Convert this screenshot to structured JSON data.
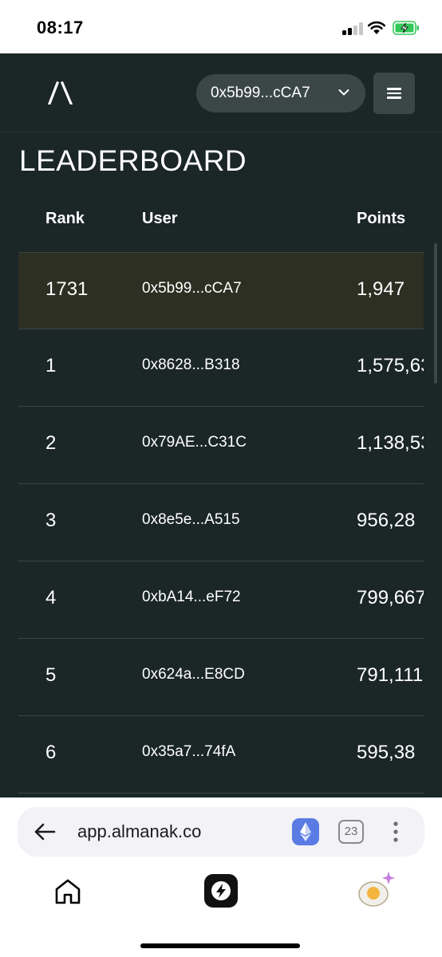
{
  "status_bar": {
    "time": "08:17"
  },
  "header": {
    "wallet_label": "0x5b99...cCA7"
  },
  "page": {
    "title": "LEADERBOARD"
  },
  "table": {
    "columns": [
      "Rank",
      "User",
      "Points"
    ],
    "rows": [
      {
        "rank": "1731",
        "user": "0x5b99...cCA7",
        "points": "1,947",
        "highlight": true
      },
      {
        "rank": "1",
        "user": "0x8628...B318",
        "points": "1,575,63"
      },
      {
        "rank": "2",
        "user": "0x79AE...C31C",
        "points": "1,138,53"
      },
      {
        "rank": "3",
        "user": "0x8e5e...A515",
        "points": "956,28"
      },
      {
        "rank": "4",
        "user": "0xbA14...eF72",
        "points": "799,667"
      },
      {
        "rank": "5",
        "user": "0x624a...E8CD",
        "points": "791,111"
      },
      {
        "rank": "6",
        "user": "0x35a7...74fA",
        "points": "595,38"
      }
    ]
  },
  "browser": {
    "url": "app.almanak.co",
    "tab_count": "23"
  },
  "colors": {
    "app_background": "#1b2626",
    "highlight_row": "#2c2f22",
    "button_background": "#3b4646",
    "battery_charging": "#34c759"
  },
  "icons": [
    "almanak-logo-icon",
    "chevron-down-icon",
    "menu-icon",
    "back-arrow-icon",
    "ethereum-icon",
    "tabs-icon",
    "more-icon",
    "home-icon",
    "bolt-icon",
    "egg-icon"
  ]
}
